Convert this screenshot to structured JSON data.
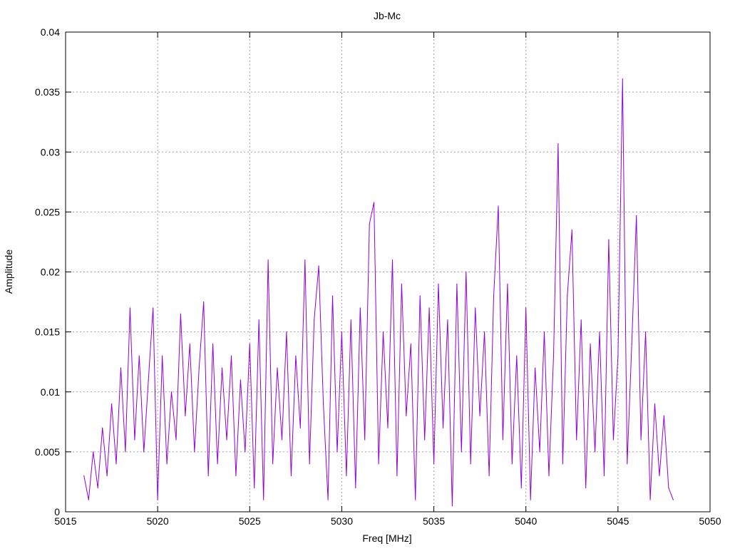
{
  "chart_data": {
    "type": "line",
    "title": "Jb-Mc",
    "xlabel": "Freq [MHz]",
    "ylabel": "Amplitude",
    "xlim": [
      5015,
      5050
    ],
    "ylim": [
      0,
      0.04
    ],
    "grid": true,
    "xticks": [
      "5015",
      "5020",
      "5025",
      "5030",
      "5035",
      "5040",
      "5045",
      "5050"
    ],
    "yticks": [
      "0",
      "0.005",
      "0.01",
      "0.015",
      "0.02",
      "0.025",
      "0.03",
      "0.035",
      "0.04"
    ],
    "series": [
      {
        "name": "Jb-Mc",
        "color": "#9400d3",
        "x_start": 5016,
        "x_step": 0.25,
        "values": [
          0.003,
          0.001,
          0.005,
          0.002,
          0.007,
          0.003,
          0.009,
          0.004,
          0.012,
          0.005,
          0.017,
          0.006,
          0.013,
          0.005,
          0.011,
          0.017,
          0.001,
          0.013,
          0.004,
          0.01,
          0.006,
          0.0165,
          0.008,
          0.014,
          0.005,
          0.012,
          0.0175,
          0.003,
          0.014,
          0.004,
          0.012,
          0.006,
          0.013,
          0.003,
          0.011,
          0.005,
          0.014,
          0.002,
          0.016,
          0.001,
          0.021,
          0.004,
          0.012,
          0.006,
          0.015,
          0.003,
          0.013,
          0.007,
          0.021,
          0.004,
          0.016,
          0.0205,
          0.009,
          0.001,
          0.018,
          0.005,
          0.015,
          0.003,
          0.016,
          0.002,
          0.017,
          0.006,
          0.024,
          0.0258,
          0.004,
          0.015,
          0.007,
          0.021,
          0.003,
          0.019,
          0.008,
          0.014,
          0.001,
          0.018,
          0.006,
          0.017,
          0.004,
          0.019,
          0.007,
          0.016,
          0.0005,
          0.019,
          0.005,
          0.02,
          0.004,
          0.017,
          0.008,
          0.015,
          0.003,
          0.018,
          0.0255,
          0.006,
          0.019,
          0.004,
          0.013,
          0.002,
          0.017,
          0.001,
          0.012,
          0.005,
          0.015,
          0.003,
          0.013,
          0.0307,
          0.004,
          0.018,
          0.0235,
          0.006,
          0.016,
          0.002,
          0.014,
          0.005,
          0.015,
          0.003,
          0.0227,
          0.006,
          0.013,
          0.0361,
          0.004,
          0.014,
          0.0247,
          0.006,
          0.015,
          0.001,
          0.009,
          0.003,
          0.008,
          0.002,
          0.001
        ]
      }
    ]
  }
}
